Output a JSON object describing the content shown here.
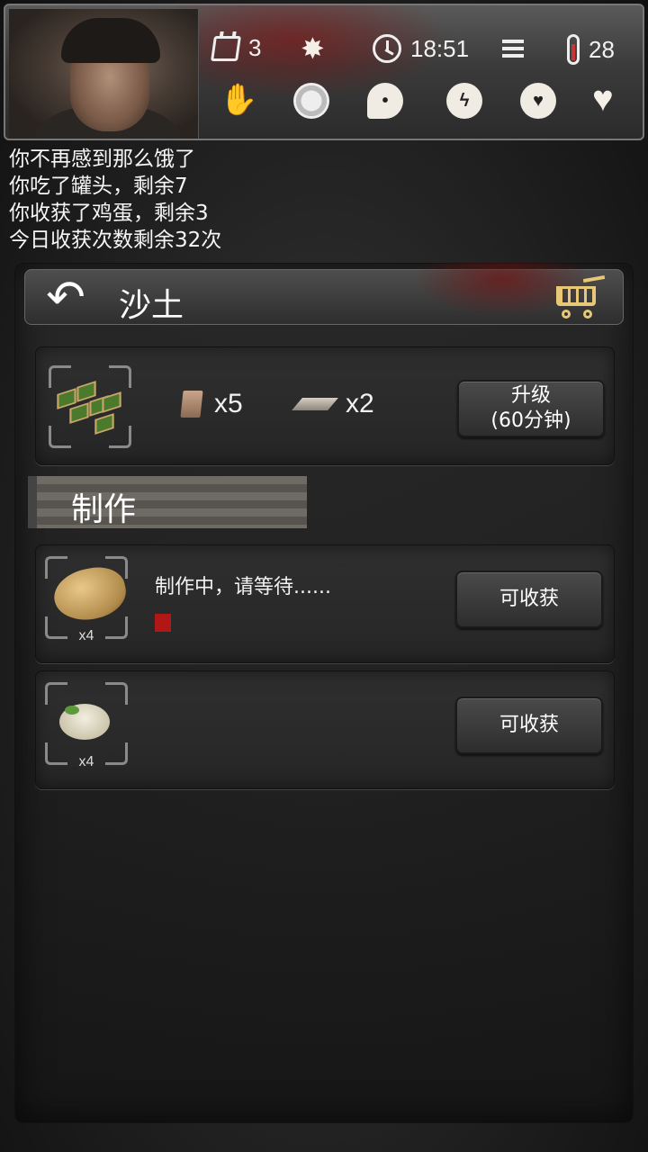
{
  "topbar": {
    "day": "3",
    "time": "18:51",
    "temperature": "28",
    "icons": [
      "calendar-icon",
      "sun-icon",
      "clock-icon",
      "menu-icon",
      "thermometer-icon",
      "health-icon",
      "fatigue-icon",
      "hunger-icon",
      "mind-icon",
      "mood-icon",
      "heart-icon"
    ]
  },
  "log": [
    "你不再感到那么饿了",
    "你吃了罐头，剩余7",
    "你收获了鸡蛋，剩余3",
    "今日收获次数剩余32次"
  ],
  "panel": {
    "title": "沙土",
    "building": {
      "resources": [
        {
          "name": "brick",
          "count": "x5"
        },
        {
          "name": "plank",
          "count": "x2"
        }
      ],
      "upgrade_label": "升级",
      "upgrade_time": "(60分钟)"
    },
    "section_title": "制作",
    "crafts": [
      {
        "item": "potato",
        "qty": "x4",
        "status": "制作中，请等待......",
        "button": "可收获",
        "progress": 0.03
      },
      {
        "item": "sprouted-potato",
        "qty": "x4",
        "status": "",
        "button": "可收获"
      }
    ]
  },
  "colors": {
    "accent_gold": "#e8c878",
    "progress_red": "#b01818"
  }
}
